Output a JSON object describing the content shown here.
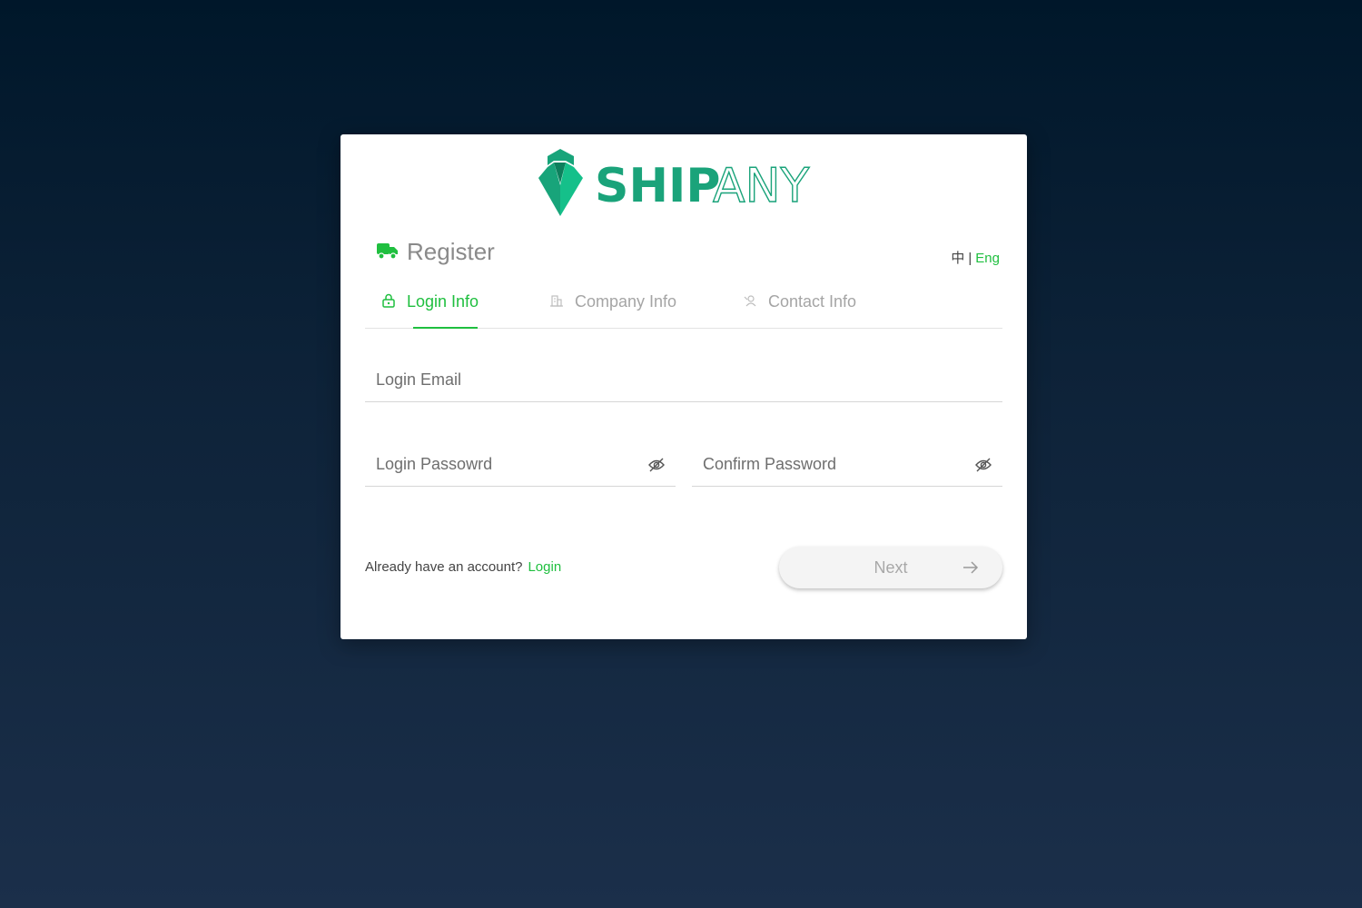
{
  "brand": {
    "name_part1": "SHIP",
    "name_part2": "ANY",
    "color_primary": "#1aa37a",
    "color_accent": "#1fbf3f"
  },
  "header": {
    "icon": "truck-icon",
    "title": "Register",
    "lang_zh": "中",
    "lang_sep": "|",
    "lang_en": "Eng"
  },
  "tabs": [
    {
      "label": "Login Info",
      "icon": "lock-icon",
      "active": true
    },
    {
      "label": "Company Info",
      "icon": "building-icon",
      "active": false
    },
    {
      "label": "Contact Info",
      "icon": "contact-person-icon",
      "active": false
    }
  ],
  "form": {
    "email_placeholder": "Login Email",
    "email_value": "",
    "password_placeholder": "Login Passowrd",
    "password_value": "",
    "confirm_placeholder": "Confirm Password",
    "confirm_value": ""
  },
  "footer": {
    "prompt": "Already have an account?",
    "login_link": "Login",
    "next_label": "Next"
  }
}
